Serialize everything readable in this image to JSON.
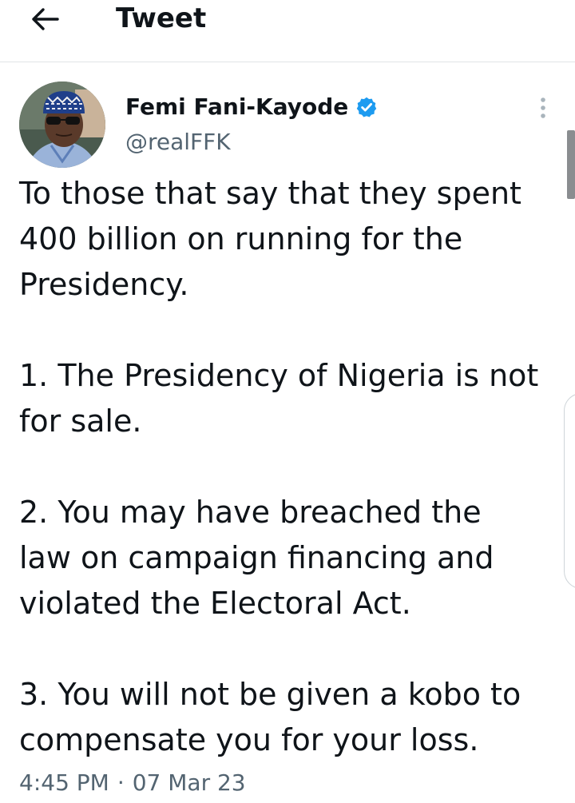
{
  "header": {
    "back_icon": "arrow-left-icon",
    "title": "Tweet"
  },
  "author": {
    "name": "Femi Fani-Kayode",
    "handle": "@realFFK",
    "verified": true,
    "verified_color": "#1d9bf0"
  },
  "tweet": {
    "lines": [
      "To those that say that they spent",
      "400 billion on running for the",
      "Presidency.",
      "",
      "1. The Presidency of Nigeria is not",
      "for sale.",
      "",
      "2. You may have breached the",
      "law on campaign financing and",
      "violated the Electoral Act.",
      "",
      "3. You will not be given a kobo to",
      "compensate you for your loss."
    ],
    "time": "4:45 PM",
    "separator": "·",
    "date": "07 Mar 23"
  },
  "colors": {
    "text": "#0f1419",
    "secondary": "#536471",
    "divider": "#e1e4e7"
  }
}
